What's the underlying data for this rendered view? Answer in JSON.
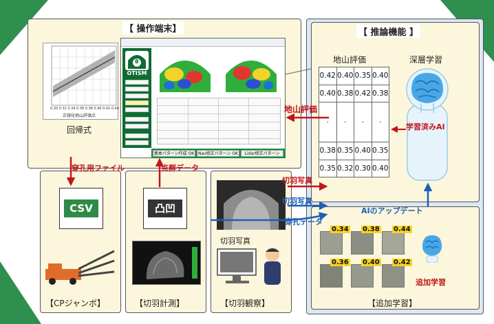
{
  "panels": {
    "terminal": "【 操作端末】",
    "inference": "【 推論機能 】",
    "cp_jumbo": "【CPジャンボ】",
    "face_measure": "【切羽計測】",
    "face_observe": "【切羽観察】",
    "additional": "【追加学習】"
  },
  "labels": {
    "regression": "回帰式",
    "drill_file": "穿孔用ファイル",
    "point_cloud": "点群データ",
    "ground_eval_arrow": "地山評価",
    "face_photo_red": "切羽写真",
    "face_photo_blue": "切羽写真",
    "drill_data": "穿孔データ",
    "ground_eval_title": "地山評価",
    "deep_learning": "深層学習",
    "trained_ai": "学習済みAI",
    "ai_update": "AIのアップデート",
    "add_learning": "追加学習",
    "face_photo_obs": "切羽写真"
  },
  "files": {
    "csv": "CSV",
    "pointcloud": "凸凹"
  },
  "terminal_ui": {
    "logo_num": "8",
    "logo_text": "OTISM",
    "btn1": "基本パターン作成 OK",
    "btn2": "Nav修正パターン OK",
    "btn3": "Lidar修正パターン"
  },
  "reg_chart": {
    "x_ticks": [
      "0.30",
      "0.32",
      "0.34",
      "0.36",
      "0.38",
      "0.40",
      "0.42",
      "0.44"
    ],
    "xlabel": "正規化地山評価点"
  },
  "ground_table": {
    "rows": [
      [
        "0.42",
        "0.40",
        "0.35",
        "0.40"
      ],
      [
        "0.40",
        "0.38",
        "0.42",
        "0.38"
      ],
      [
        "·",
        "·",
        "·",
        "·"
      ],
      [
        "0.38",
        "0.35",
        "0.40",
        "0.35"
      ],
      [
        "0.35",
        "0.32",
        "0.30",
        "0.40"
      ]
    ]
  },
  "thumbs": {
    "values": [
      "0.34",
      "0.38",
      "0.44",
      "0.36",
      "0.40",
      "0.42"
    ]
  },
  "colors": {
    "red": "#c0161c",
    "blue": "#1d5fb8",
    "green": "#0f6b34",
    "cream": "#fbf6dc",
    "lightblue": "#dbe8f5"
  }
}
